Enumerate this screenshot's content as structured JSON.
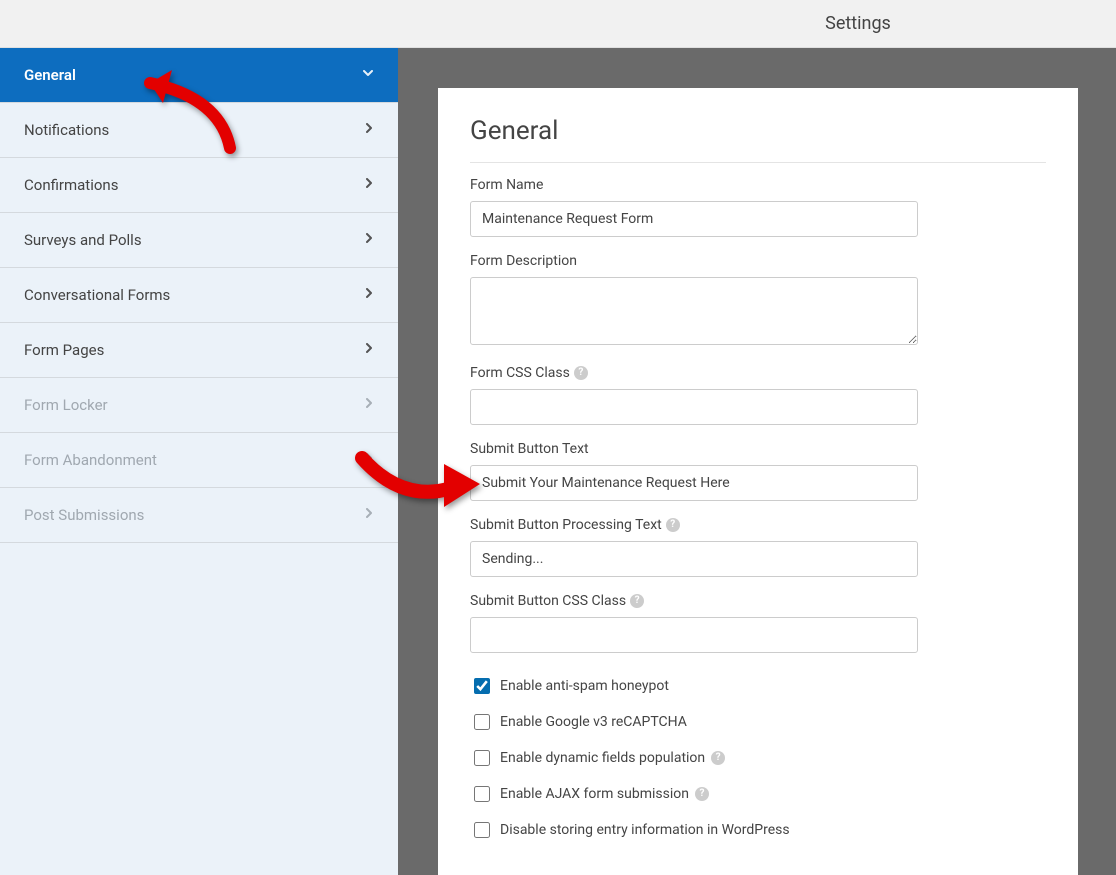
{
  "topbar": {
    "title": "Settings"
  },
  "sidebar": {
    "items": [
      {
        "label": "General",
        "active": true,
        "disabled": false,
        "chev": "down"
      },
      {
        "label": "Notifications",
        "active": false,
        "disabled": false,
        "chev": "right"
      },
      {
        "label": "Confirmations",
        "active": false,
        "disabled": false,
        "chev": "right"
      },
      {
        "label": "Surveys and Polls",
        "active": false,
        "disabled": false,
        "chev": "right"
      },
      {
        "label": "Conversational Forms",
        "active": false,
        "disabled": false,
        "chev": "right"
      },
      {
        "label": "Form Pages",
        "active": false,
        "disabled": false,
        "chev": "right"
      },
      {
        "label": "Form Locker",
        "active": false,
        "disabled": true,
        "chev": "right"
      },
      {
        "label": "Form Abandonment",
        "active": false,
        "disabled": true,
        "chev": "right"
      },
      {
        "label": "Post Submissions",
        "active": false,
        "disabled": true,
        "chev": "right"
      }
    ]
  },
  "panel": {
    "heading": "General",
    "fields": {
      "form_name": {
        "label": "Form Name",
        "value": "Maintenance Request Form"
      },
      "form_description": {
        "label": "Form Description",
        "value": ""
      },
      "form_css_class": {
        "label": "Form CSS Class",
        "value": "",
        "help": true
      },
      "submit_button_text": {
        "label": "Submit Button Text",
        "value": "Submit Your Maintenance Request Here"
      },
      "submit_button_processing": {
        "label": "Submit Button Processing Text",
        "value": "Sending...",
        "help": true
      },
      "submit_button_css_class": {
        "label": "Submit Button CSS Class",
        "value": "",
        "help": true
      }
    },
    "checkboxes": [
      {
        "label": "Enable anti-spam honeypot",
        "checked": true,
        "help": false
      },
      {
        "label": "Enable Google v3 reCAPTCHA",
        "checked": false,
        "help": false
      },
      {
        "label": "Enable dynamic fields population",
        "checked": false,
        "help": true
      },
      {
        "label": "Enable AJAX form submission",
        "checked": false,
        "help": true
      },
      {
        "label": "Disable storing entry information in WordPress",
        "checked": false,
        "help": false
      }
    ]
  }
}
